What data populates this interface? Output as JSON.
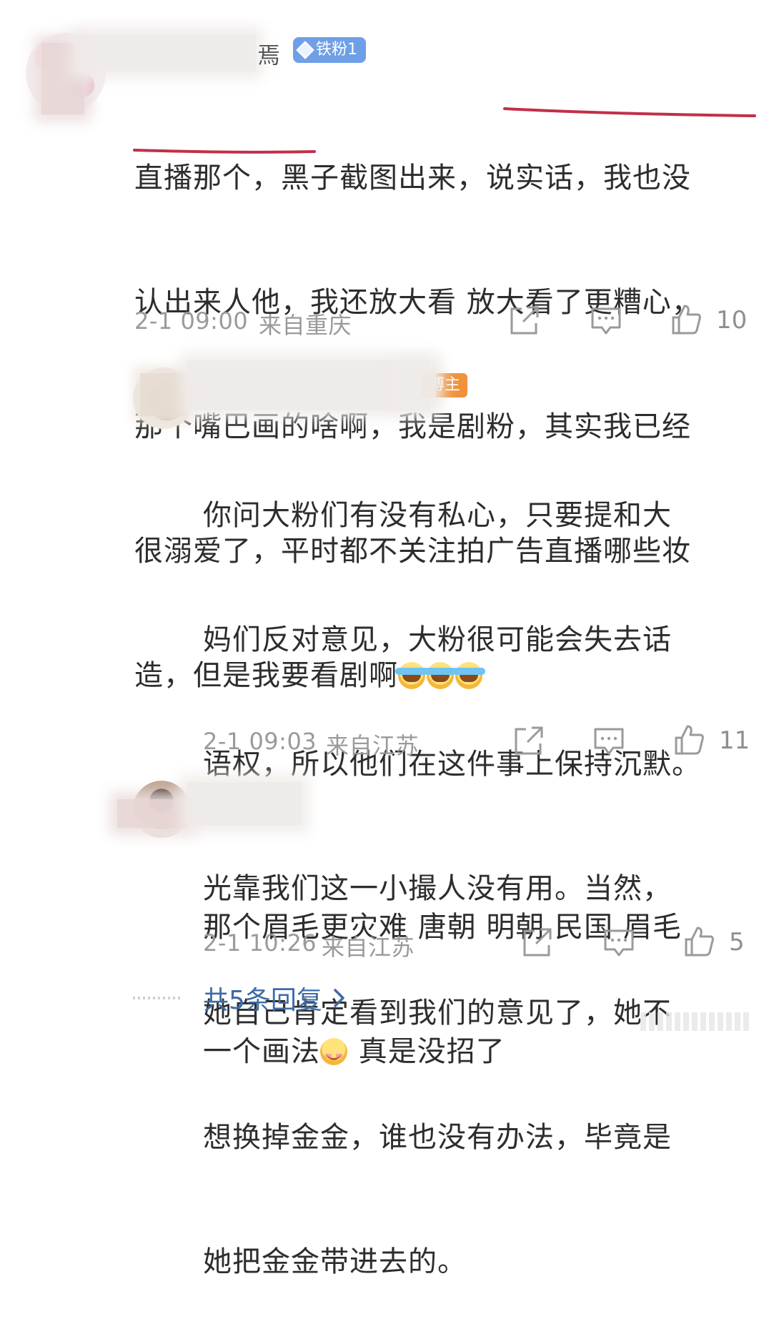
{
  "comments": [
    {
      "name_fragment": "焉",
      "badge": "铁粉1",
      "lines": [
        "直播那个，黑子截图出来，说实话，我也没",
        "认出来人他，我还放大看 放大看了更糟心，",
        "那个嘴巴画的啥啊，我是剧粉，其实我已经",
        "很溺爱了，平时都不关注拍广告直播哪些妆",
        "造，但是我要看剧啊"
      ],
      "time": "2-1 09:00",
      "location": "来自重庆",
      "likes": "10"
    },
    {
      "badge": "博主",
      "lines": [
        "你问大粉们有没有私心，只要提和大",
        "妈们反对意见，大粉很可能会失去话",
        "语权，所以他们在这件事上保持沉默。",
        "光靠我们这一小撮人没有用。当然，",
        "她自己肯定看到我们的意见了，她不",
        "想换掉金金，谁也没有办法，毕竟是",
        "她把金金带进去的。"
      ],
      "time": "2-1 09:03",
      "location": "来自江苏",
      "likes": "11"
    },
    {
      "lines": [
        "那个眉毛更灾难 唐朝 明朝 民国  眉毛",
        "一个画法"
      ],
      "line2_suffix": " 真是没招了",
      "time": "2-1 10:26",
      "location": "来自江苏",
      "likes": "5"
    }
  ],
  "more_replies": "共5条回复",
  "colors": {
    "link": "#3e6ba8",
    "underline": "#c03048",
    "iron_badge": "#6f9fe6",
    "blogger_badge": "#f0913c"
  },
  "icons": [
    "share-icon",
    "comment-icon",
    "like-icon",
    "chevron-right-icon",
    "laugh-cry-emoji",
    "smile-emoji"
  ]
}
